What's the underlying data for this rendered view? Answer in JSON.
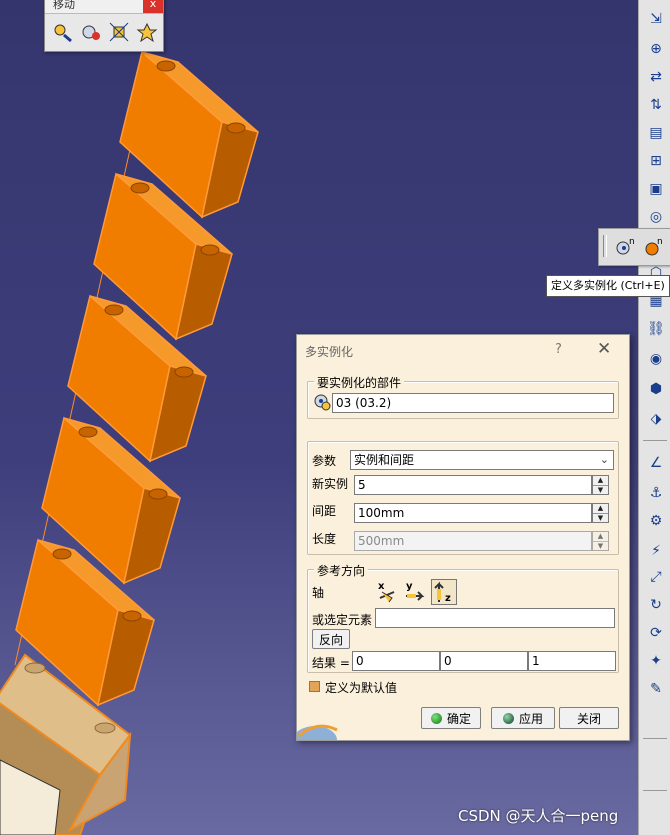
{
  "move_toolbar": {
    "title": "移动",
    "close": "x",
    "buttons": [
      "manipulate-icon",
      "snap-icon",
      "smart-move-icon",
      "explode-icon"
    ]
  },
  "tooltip": "定义多实例化 (Ctrl+E)",
  "dialog": {
    "title": "多实例化",
    "help": "?",
    "close": "✕",
    "part_group": {
      "legend": "要实例化的部件",
      "part_value": "03 (03.2)"
    },
    "params": {
      "param_label": "参数",
      "param_value": "实例和间距",
      "new_instances_label": "新实例",
      "new_instances_value": "5",
      "spacing_label": "间距",
      "spacing_value": "100mm",
      "length_label": "长度",
      "length_value": "500mm"
    },
    "reference_direction": {
      "legend": "参考方向",
      "axis_label": "轴",
      "axis_buttons": [
        "x",
        "y",
        "z"
      ],
      "selected_axis": "z",
      "or_select_label": "或选定元素",
      "or_select_value": "",
      "reverse_label": "反向",
      "result_label": "结果 =",
      "result_values": [
        "0",
        "0",
        "1"
      ]
    },
    "default_checkbox_label": "定义为默认值",
    "default_checked": true,
    "ok_label": "确定",
    "apply_label": "应用",
    "close_label": "关闭"
  },
  "watermark": "CSDN @天人合一peng",
  "colors": {
    "background": "#3e3e7c",
    "dialog_bg": "#fbf0dc",
    "part_orange": "#f07c00",
    "part_tan": "#c8a06a",
    "tooltip_bg": "#ffffff"
  },
  "right_toolbar_icons": [
    "insert-component-icon",
    "insert-product-icon",
    "replace-icon",
    "reorder-icon",
    "graph-tree-icon",
    "generate-numbering-icon",
    "selective-load-icon",
    "multi-instantiation-icon",
    "fast-multi-instantiation-icon",
    "reuse-pattern-icon",
    "bill-of-materials-icon",
    "constraints-icon",
    "coincidence-icon",
    "contact-icon",
    "offset-icon",
    "angle-icon",
    "fix-icon",
    "fix-together-icon",
    "quick-constraint-icon",
    "flexible-icon",
    "change-constraint-icon",
    "update-icon",
    "sensor-icon",
    "annotation-icon"
  ]
}
